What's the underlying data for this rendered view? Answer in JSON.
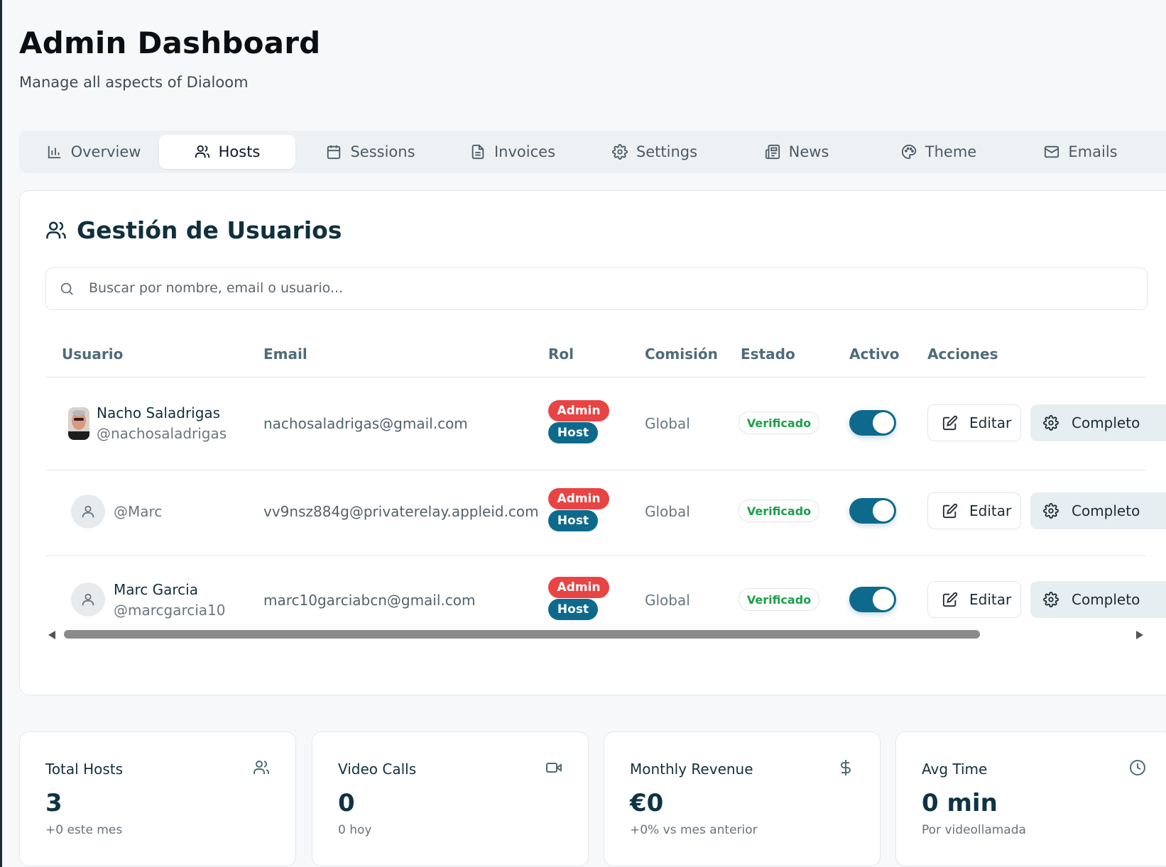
{
  "page": {
    "title": "Admin Dashboard",
    "subtitle": "Manage all aspects of Dialoom"
  },
  "tabs": [
    {
      "label": "Overview",
      "icon": "bar-chart-icon",
      "active": false
    },
    {
      "label": "Hosts",
      "icon": "users-icon",
      "active": true
    },
    {
      "label": "Sessions",
      "icon": "calendar-icon",
      "active": false
    },
    {
      "label": "Invoices",
      "icon": "file-text-icon",
      "active": false
    },
    {
      "label": "Settings",
      "icon": "gear-icon",
      "active": false
    },
    {
      "label": "News",
      "icon": "newspaper-icon",
      "active": false
    },
    {
      "label": "Theme",
      "icon": "palette-icon",
      "active": false
    },
    {
      "label": "Emails",
      "icon": "mail-icon",
      "active": false
    }
  ],
  "users_card": {
    "title": "Gestión de Usuarios",
    "search_placeholder": "Buscar por nombre, email o usuario...",
    "search_value": "",
    "columns": [
      "Usuario",
      "Email",
      "Rol",
      "Comisión",
      "Estado",
      "Activo",
      "Acciones"
    ],
    "rows": [
      {
        "name": "Nacho Saladrigas",
        "handle": "@nachosaladrigas",
        "email": "nachosaladrigas@gmail.com",
        "roles": [
          "Admin",
          "Host"
        ],
        "commission": "Global",
        "status": "Verificado",
        "active": true,
        "edit_label": "Editar",
        "complete_label": "Completo",
        "avatar": "photo"
      },
      {
        "name": "",
        "handle": "@Marc",
        "email": "vv9nsz884g@privaterelay.appleid.com",
        "roles": [
          "Admin",
          "Host"
        ],
        "commission": "Global",
        "status": "Verificado",
        "active": true,
        "edit_label": "Editar",
        "complete_label": "Completo",
        "avatar": "default"
      },
      {
        "name": "Marc Garcia",
        "handle": "@marcgarcia10",
        "email": "marc10garciabcn@gmail.com",
        "roles": [
          "Admin",
          "Host"
        ],
        "commission": "Global",
        "status": "Verificado",
        "active": true,
        "edit_label": "Editar",
        "complete_label": "Completo",
        "avatar": "default"
      }
    ]
  },
  "stats": [
    {
      "label": "Total Hosts",
      "value": "3",
      "sub": "+0 este mes",
      "icon": "users-icon"
    },
    {
      "label": "Video Calls",
      "value": "0",
      "sub": "0 hoy",
      "icon": "video-icon"
    },
    {
      "label": "Monthly Revenue",
      "value": "€0",
      "sub": "+0% vs mes anterior",
      "icon": "dollar-icon"
    },
    {
      "label": "Avg Time",
      "value": "0 min",
      "sub": "Por videollamada",
      "icon": "clock-icon"
    }
  ],
  "colors": {
    "accent": "#0e6a8c",
    "admin_badge": "#e84444",
    "verified_text": "#1ba04a"
  }
}
